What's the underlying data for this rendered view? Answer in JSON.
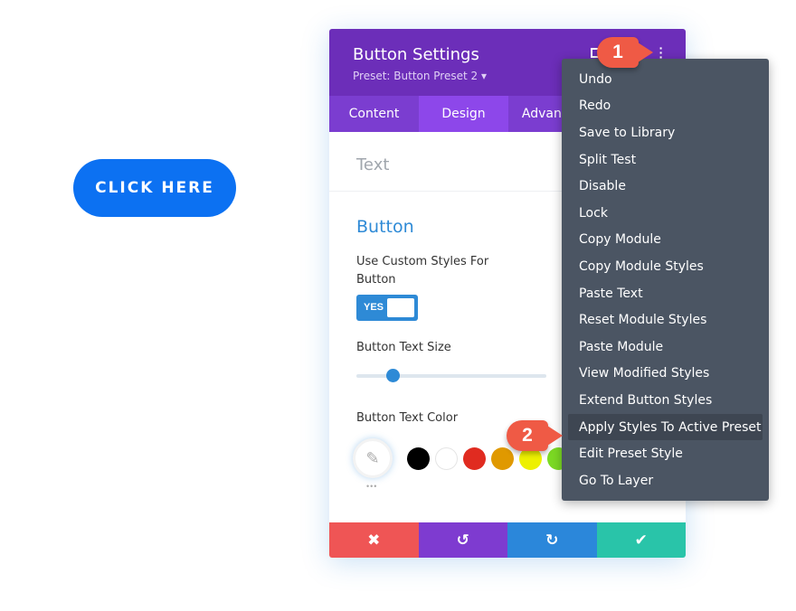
{
  "page": {
    "cta_label": "CLICK HERE"
  },
  "panel": {
    "title": "Button Settings",
    "preset": "Preset: Button Preset 2 ▾",
    "tabs": [
      "Content",
      "Design",
      "Advanced"
    ],
    "section_text": "Text",
    "section_button": "Button",
    "custom_styles_label": "Use Custom Styles For Button",
    "toggle_value": "YES",
    "text_size_label": "Button Text Size",
    "text_size_slider_fraction": 0.19,
    "text_color_label": "Button Text Color",
    "more": "•••",
    "swatches": [
      "#000000",
      "#ffffff",
      "#e02b20",
      "#e09900",
      "#edf000",
      "#7cda24"
    ]
  },
  "footer": {
    "cancel": "✖",
    "undo": "↺",
    "redo": "↻",
    "save": "✔",
    "colors": [
      "#ef5555",
      "#7e3bd0",
      "#2b87da",
      "#29c4a9"
    ]
  },
  "menu": {
    "items": [
      "Undo",
      "Redo",
      "Save to Library",
      "Split Test",
      "Disable",
      "Lock",
      "Copy Module",
      "Copy Module Styles",
      "Paste Text",
      "Reset Module Styles",
      "Paste Module",
      "View Modified Styles",
      "Extend Button Styles",
      "Apply Styles To Active Preset",
      "Edit Preset Style",
      "Go To Layer"
    ],
    "highlighted": "Apply Styles To Active Preset"
  },
  "callouts": [
    "1",
    "2"
  ]
}
